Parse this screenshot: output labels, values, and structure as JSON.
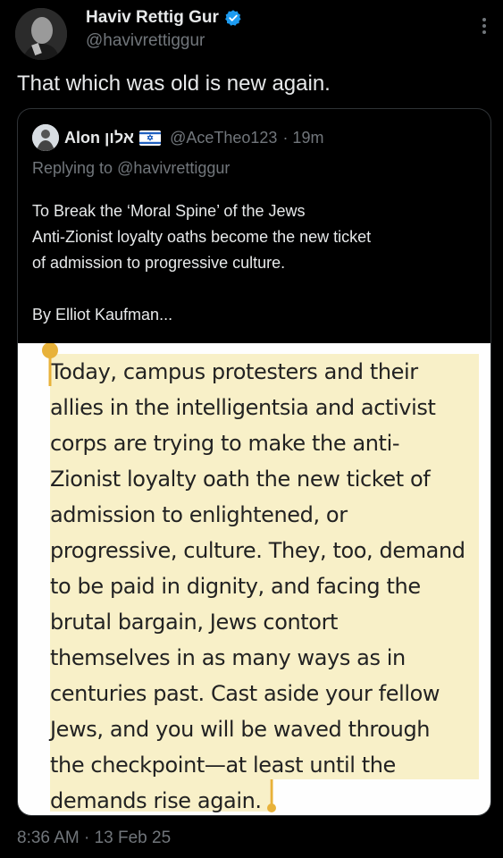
{
  "author": {
    "display_name": "Haviv Rettig Gur",
    "handle": "@havivrettiggur",
    "verified": true
  },
  "tweet": {
    "text": "That which was old is new again.",
    "timestamp": "8:36 AM · 13 Feb 25"
  },
  "quoted_tweet": {
    "display_name": "Alon אלון",
    "flag_icon": "israel-flag-icon",
    "handle": "@AceTheo123",
    "time": "· 19m",
    "replying_to_prefix": "Replying to ",
    "replying_to_handle": "@havivrettiggur",
    "body_lines": [
      "To Break the ‘Moral Spine’ of the Jews",
      "Anti-Zionist loyalty oaths become the new ticket",
      "of admission to progressive culture."
    ],
    "byline": "By Elliot Kaufman...",
    "image_text_lines": [
      "Today, campus protesters and their",
      "allies in the intelligentsia and activist",
      "corps are trying to make the anti-",
      "Zionist loyalty oath the new ticket of",
      "admission to enlightened, or",
      "progressive, culture. They, too, demand",
      "to be paid in dignity, and facing the",
      "brutal bargain, Jews contort",
      "themselves in as many ways as in",
      "centuries past. Cast aside your fellow",
      "Jews, and you will be waved through",
      "the checkpoint—at least until the",
      "demands rise again."
    ]
  },
  "colors": {
    "background": "#000000",
    "primary_text": "#e7e9ea",
    "secondary_text": "#71767b",
    "verified_blue": "#1d9bf0",
    "highlight": "#f8f0c8",
    "selection_handle": "#e8b23a"
  }
}
